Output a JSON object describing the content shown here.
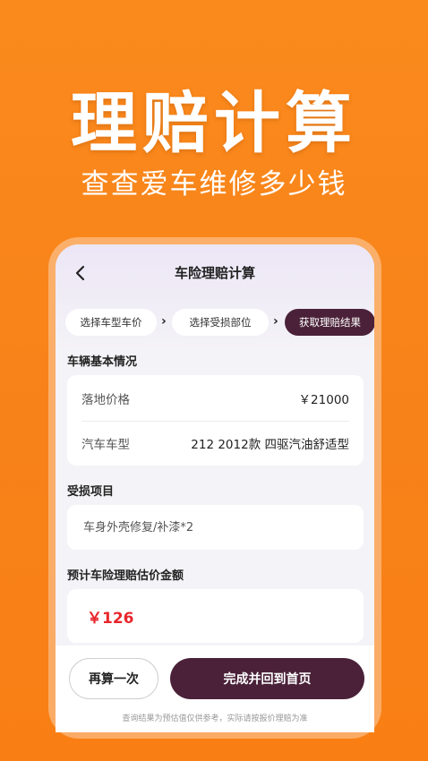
{
  "hero": {
    "title": "理赔计算",
    "subtitle": "查查爱车维修多少钱"
  },
  "nav": {
    "title": "车险理赔计算",
    "back_icon": "chevron-left-icon"
  },
  "steps": [
    {
      "label": "选择车型车价",
      "active": false
    },
    {
      "label": "选择受损部位",
      "active": false
    },
    {
      "label": "获取理赔结果",
      "active": true
    }
  ],
  "vehicle": {
    "section_title": "车辆基本情况",
    "rows": [
      {
        "label": "落地价格",
        "value": "￥21000"
      },
      {
        "label": "汽车车型",
        "value": "212 2012款 四驱汽油舒适型"
      }
    ]
  },
  "damage": {
    "section_title": "受损项目",
    "item": "车身外壳修复/补漆*2"
  },
  "estimate": {
    "section_title": "预计车险理赔估价金额",
    "amount": "￥126"
  },
  "actions": {
    "recalc_label": "再算一次",
    "done_label": "完成并回到首页",
    "disclaimer": "查询结果为预估值仅供参考，实际请按报价理赔为准"
  },
  "colors": {
    "background": "#f7821a",
    "accent_dark": "#4a2138",
    "amount_red": "#e8262b"
  }
}
